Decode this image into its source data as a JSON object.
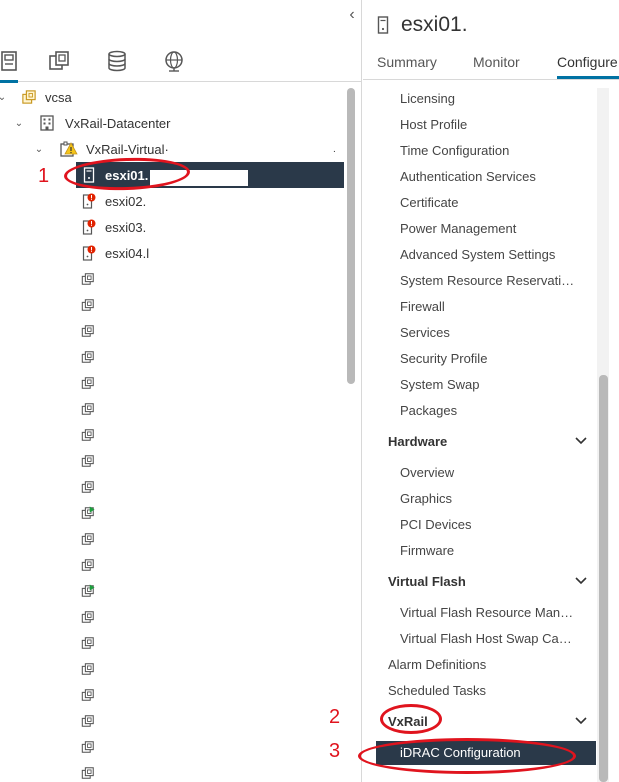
{
  "left_pane": {
    "collapse_glyph": "‹",
    "view_tabs": [
      {
        "name": "hosts-and-clusters",
        "icon": "hosts-clusters-icon",
        "active": true
      },
      {
        "name": "vms-and-templates",
        "icon": "vms-templates-icon",
        "active": false
      },
      {
        "name": "storage",
        "icon": "storage-icon",
        "active": false
      },
      {
        "name": "networking",
        "icon": "networking-icon",
        "active": false
      }
    ],
    "tree": {
      "vcenter": "vcsa",
      "datacenter": "VxRail-Datacenter",
      "cluster": "VxRail-Virtual·",
      "cluster_suffix": ".",
      "hosts": [
        "esxi01.",
        "esxi02.",
        "esxi03.",
        "esxi04.l"
      ],
      "vm_count": 20
    }
  },
  "right_pane": {
    "title": "esxi01.",
    "tabs": [
      "Summary",
      "Monitor",
      "Configure"
    ],
    "active_tab": "Configure",
    "system_items": [
      "Licensing",
      "Host Profile",
      "Time Configuration",
      "Authentication Services",
      "Certificate",
      "Power Management",
      "Advanced System Settings",
      "System Resource Reservati…",
      "Firewall",
      "Services",
      "Security Profile",
      "System Swap",
      "Packages"
    ],
    "hardware": {
      "label": "Hardware",
      "items": [
        "Overview",
        "Graphics",
        "PCI Devices",
        "Firmware"
      ]
    },
    "virtual_flash": {
      "label": "Virtual Flash",
      "items": [
        "Virtual Flash Resource Man…",
        "Virtual Flash Host Swap Ca…"
      ]
    },
    "alarm_definitions": "Alarm Definitions",
    "scheduled_tasks": "Scheduled Tasks",
    "vxrail": {
      "label": "VxRail",
      "items": [
        "iDRAC Configuration"
      ]
    }
  },
  "annotations": {
    "step1": "1",
    "step2": "2",
    "step3": "3",
    "color": "#e0141e"
  },
  "colors": {
    "selected_bg": "#2a3949",
    "accent": "#0072a3",
    "warning": "#f5a623",
    "error": "#e12200",
    "vm_running": "#1e9e3e"
  }
}
